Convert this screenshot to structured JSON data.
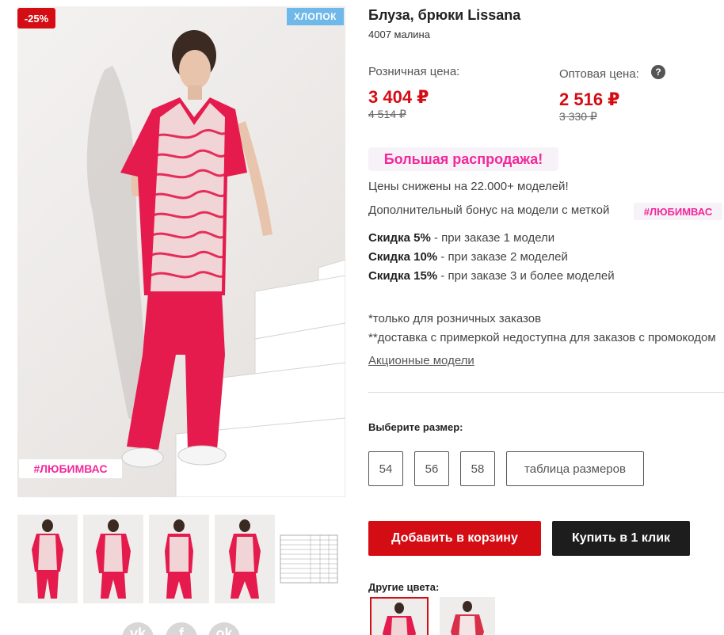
{
  "product": {
    "title": "Блуза, брюки Lissana",
    "article": "4007 малина"
  },
  "badges": {
    "discount": "-25%",
    "material": "ХЛОПОК",
    "hashtag": "#ЛЮБИМВАС"
  },
  "prices": {
    "retail_label": "Розничная цена:",
    "retail_value": "3 404 ₽",
    "retail_old": "4 514 ₽",
    "wholesale_label": "Оптовая цена:",
    "wholesale_value": "2 516 ₽",
    "wholesale_old": "3 330 ₽",
    "help_icon": "question-circle-icon"
  },
  "promo": {
    "banner": "Большая распродажа!",
    "line1": "Цены снижены на 22.000+ моделей!",
    "line2": "Дополнительный бонус на модели с меткой",
    "hashtag": "#ЛЮБИМВАС",
    "discounts": [
      {
        "label": "Скидка 5%",
        "text": " - при заказе 1 модели"
      },
      {
        "label": "Скидка 10%",
        "text": " - при заказе 2 моделей"
      },
      {
        "label": "Скидка 15%",
        "text": " - при заказе 3 и более моделей"
      }
    ],
    "note1": "*только для розничных заказов",
    "note2": "**доставка с примеркой недоступна для заказов с промокодом",
    "link": "Акционные модели"
  },
  "sizes": {
    "label": "Выберите размер:",
    "options": [
      "54",
      "56",
      "58"
    ],
    "table_button": "таблица размеров"
  },
  "actions": {
    "add_to_cart": "Добавить в корзину",
    "buy_one_click": "Купить в 1 клик"
  },
  "colors": {
    "label": "Другие цвета:"
  },
  "social": {
    "icons": [
      "vk-icon",
      "facebook-icon",
      "odnoklassniki-icon"
    ],
    "glyphs": [
      "vk",
      "f",
      "ok"
    ]
  },
  "theme": {
    "accent_red": "#d40d15",
    "pink": "#f2289b",
    "badge_blue": "#6fb9ea",
    "product_color": "#e41b4c"
  }
}
